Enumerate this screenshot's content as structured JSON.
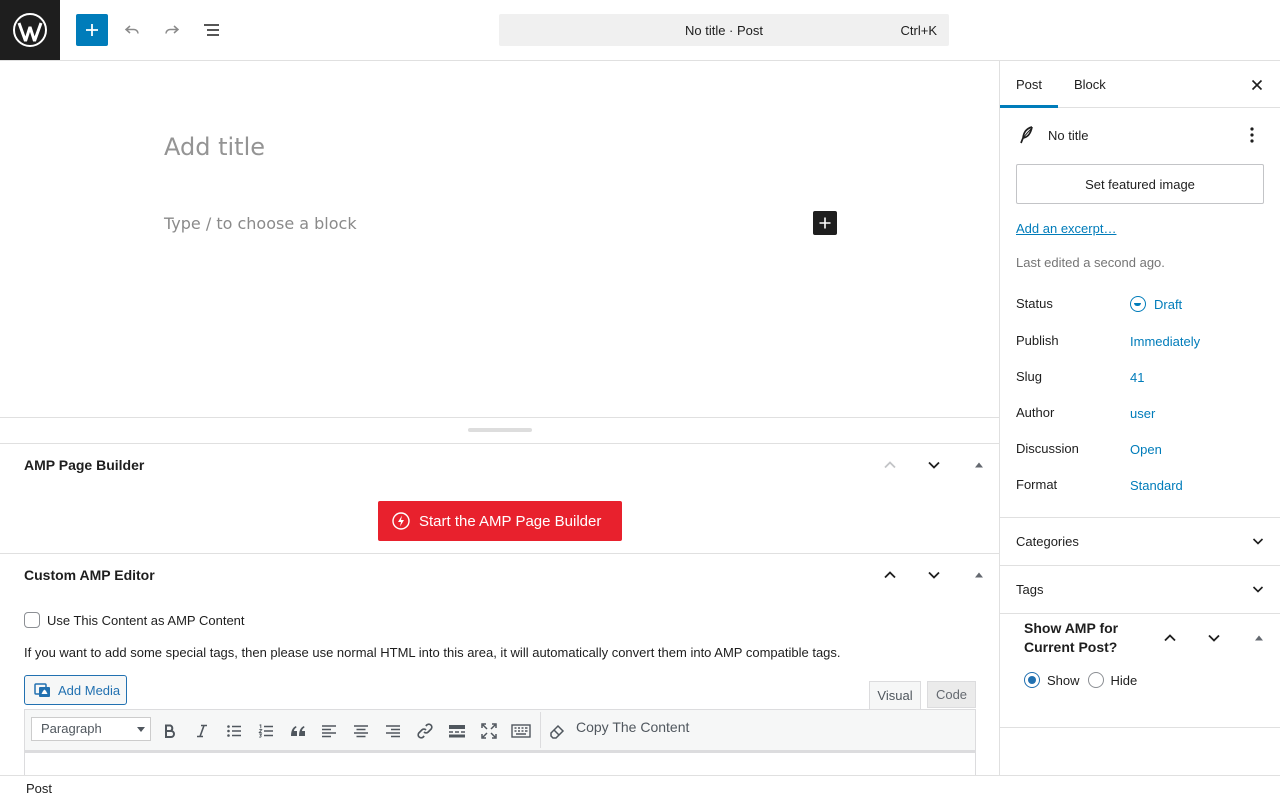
{
  "header": {
    "command_bar": "No title · Post",
    "command_shortcut": "Ctrl+K"
  },
  "editor": {
    "title_placeholder": "Add title",
    "block_placeholder": "Type / to choose a block"
  },
  "amp_page_builder": {
    "title": "AMP Page Builder",
    "start_button": "Start the AMP Page Builder"
  },
  "custom_amp_editor": {
    "title": "Custom AMP Editor",
    "use_content_label": "Use This Content as AMP Content",
    "use_content_checked": false,
    "help_text": "If you want to add some special tags, then please use normal HTML into this area, it will automatically convert them into AMP compatible tags.",
    "add_media": "Add Media",
    "tab_visual": "Visual",
    "tab_code": "Code",
    "format_select": "Paragraph",
    "copy_content": "Copy The Content"
  },
  "footer": {
    "breadcrumb": "Post"
  },
  "sidebar": {
    "tab_post": "Post",
    "tab_block": "Block",
    "post_title": "No title",
    "featured_image_button": "Set featured image",
    "excerpt_link": "Add an excerpt…",
    "last_edited": "Last edited a second ago.",
    "properties": [
      {
        "label": "Status",
        "value": "Draft"
      },
      {
        "label": "Publish",
        "value": "Immediately"
      },
      {
        "label": "Slug",
        "value": "41"
      },
      {
        "label": "Author",
        "value": "user"
      },
      {
        "label": "Discussion",
        "value": "Open"
      },
      {
        "label": "Format",
        "value": "Standard"
      }
    ],
    "sections": [
      "Categories",
      "Tags"
    ],
    "amp_box": {
      "title": "Show AMP for Current Post?",
      "option_show": "Show",
      "option_hide": "Hide",
      "selected": "Show"
    }
  },
  "colors": {
    "accent": "#007cba",
    "amp_red": "#e8212d",
    "dark": "#1e1e1e"
  }
}
